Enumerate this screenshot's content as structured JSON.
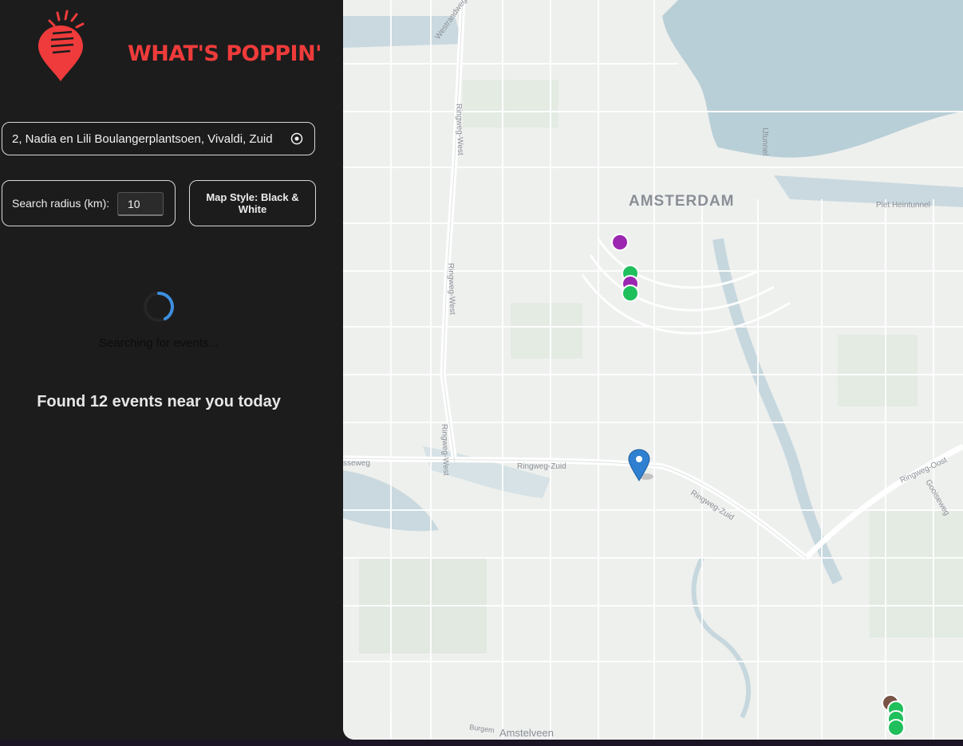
{
  "app": {
    "name": "WHAT'S POPPIN'"
  },
  "search": {
    "address_value": "2, Nadia en Lili Boulangerplantsoen, Vivaldi, Zuid",
    "locate_icon": "crosshair-icon",
    "radius_label": "Search radius (km):",
    "radius_value": "10",
    "map_style_label": "Map Style: Black & White"
  },
  "status": {
    "searching_text": "Searching for events...",
    "found_text": "Found 12 events near you today"
  },
  "map": {
    "labels": {
      "city": "AMSTERDAM",
      "ringweg_west_1": "Ringweg-West",
      "ringweg_west_2": "Ringweg-West",
      "ringweg_west_3": "Ringweg-West",
      "ringweg_zuid_1": "Ringweg-Zuid",
      "ringweg_zuid_2": "Ringweg-Zuid",
      "ringweg_oost": "Ringweg-Oost",
      "amstelveen": "Amstelveen",
      "piet_heintunnel": "Piet Heintunnel",
      "ijtunnel": "IJtunnel",
      "coentunnel_road": "Westrandweg",
      "burgemeester": "Burgem",
      "gooiseweg": "Gooiseweg",
      "sseweg": "sseweg"
    },
    "colors": {
      "music": "#9b27b0",
      "arts": "#1fbf5c",
      "food": "#795548",
      "user": "#2f80d1"
    }
  }
}
